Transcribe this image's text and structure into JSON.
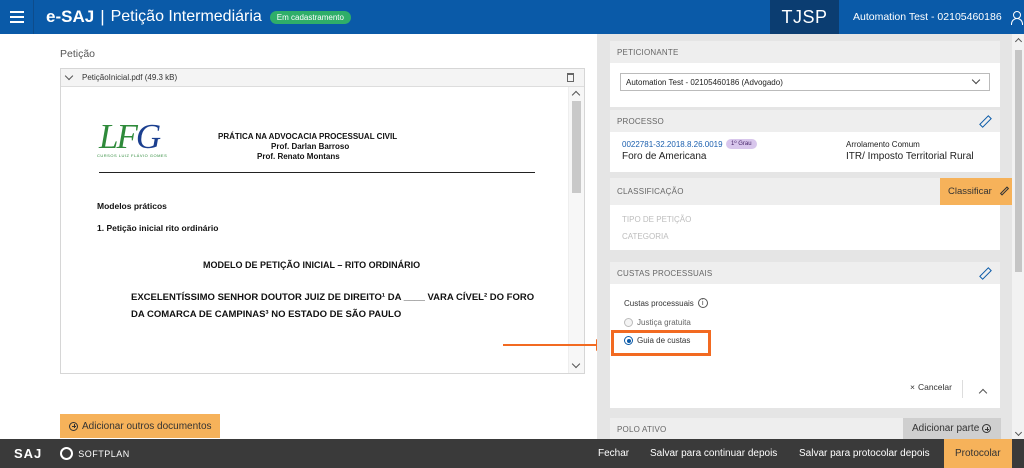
{
  "header": {
    "app_name": "e-SAJ",
    "separator": "|",
    "page_title": "Petição Intermediária",
    "status_badge": "Em cadastramento",
    "court": "TJSP",
    "user": "Automation Test - 02105460186"
  },
  "left": {
    "section_label": "Petição",
    "file": {
      "name": "PetiçãoInicial.pdf (49.3 kB)"
    },
    "document": {
      "logo_text_1": "LF",
      "logo_text_2": "G",
      "logo_sub": "CURSOS LUIZ FLÁVIO GOMES",
      "heading": "PRÁTICA NA ADVOCACIA PROCESSUAL CIVIL",
      "prof1": "Prof. Darlan Barroso",
      "prof2": "Prof. Renato Montans",
      "line1": "Modelos práticos",
      "line2": "1. Petição inicial rito ordinário",
      "line3": "MODELO DE PETIÇÃO INICIAL – RITO ORDINÁRIO",
      "line4": "EXCELENTÍSSIMO SENHOR DOUTOR JUIZ DE DIREITO¹ DA ____ VARA CÍVEL² DO FORO",
      "line5": "DA COMARCA DE CAMPINAS³ NO ESTADO DE SÃO PAULO"
    },
    "add_docs_label": "Adicionar outros documentos"
  },
  "right": {
    "peticionante": {
      "header": "PETICIONANTE",
      "selected": "Automation Test - 02105460186 (Advogado)"
    },
    "processo": {
      "header": "PROCESSO",
      "numero": "0022781-32.2018.8.26.0019",
      "grau": "1º Grau",
      "foro": "Foro de Americana",
      "classe": "Arrolamento Comum",
      "assunto": "ITR/ Imposto Territorial Rural"
    },
    "classificacao": {
      "header": "CLASSIFICAÇÃO",
      "button": "Classificar",
      "tipo": "TIPO DE PETIÇÃO",
      "categoria": "CATEGORIA"
    },
    "custas": {
      "header": "CUSTAS PROCESSUAIS",
      "label": "Custas processuais",
      "info": "i",
      "option1": "Justiça gratuita",
      "option2": "Guia de custas",
      "cancel": "Cancelar",
      "cancel_icon": "×"
    },
    "polo": {
      "header": "POLO ATIVO",
      "button": "Adicionar parte"
    }
  },
  "footer": {
    "brand": "SAJ",
    "softplan": "SOFTPLAN",
    "fechar": "Fechar",
    "salvar_continuar": "Salvar para continuar depois",
    "salvar_protocolar": "Salvar para protocolar depois",
    "protocolar": "Protocolar"
  },
  "colors": {
    "primary": "#0a5aa8",
    "accent": "#f6b25a",
    "highlight": "#f26a21",
    "badge": "#2fae69"
  }
}
